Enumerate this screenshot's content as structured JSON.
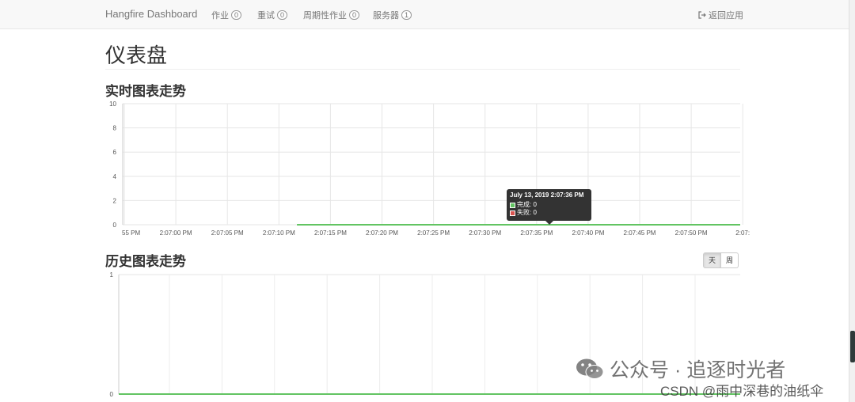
{
  "navbar": {
    "brand": "Hangfire Dashboard",
    "items": [
      {
        "label": "作业",
        "count": "0"
      },
      {
        "label": "重试",
        "count": "0"
      },
      {
        "label": "周期性作业",
        "count": "0"
      },
      {
        "label": "服务器",
        "count": "1"
      }
    ],
    "back_label": "返回应用",
    "back_icon": "sign-out-icon"
  },
  "page": {
    "title": "仪表盘",
    "realtime_title": "实时图表走势",
    "history_title": "历史图表走势",
    "range_toggle": [
      {
        "label": "天",
        "active": true
      },
      {
        "label": "周",
        "active": false
      }
    ]
  },
  "tooltip": {
    "title": "July 13, 2019 2:07:36 PM",
    "rows": [
      {
        "label": "完成: 0",
        "color": "#62c462"
      },
      {
        "label": "失败: 0",
        "color": "#d9534f"
      }
    ]
  },
  "colors": {
    "succeeded": "#62c462",
    "failed": "#d9534f"
  },
  "watermark": {
    "line1": "公众号 · 追逐时光者",
    "line2": "CSDN @雨中深巷的油纸伞",
    "icon": "wechat-icon"
  },
  "chart_data": [
    {
      "type": "line",
      "title": "实时图表走势",
      "x": [
        "55 PM",
        "2:07:00 PM",
        "2:07:05 PM",
        "2:07:10 PM",
        "2:07:15 PM",
        "2:07:20 PM",
        "2:07:25 PM",
        "2:07:30 PM",
        "2:07:35 PM",
        "2:07:40 PM",
        "2:07:45 PM",
        "2:07:50 PM",
        "2:07:"
      ],
      "yticks": [
        0,
        2,
        4,
        6,
        8,
        10
      ],
      "ylim": [
        0,
        10
      ],
      "grid": true,
      "series": [
        {
          "name": "完成",
          "values": [
            0,
            0,
            0,
            0,
            0,
            0,
            0,
            0,
            0,
            0,
            0,
            0,
            0
          ],
          "start_index": 3.35
        }
      ]
    },
    {
      "type": "line",
      "title": "历史图表走势",
      "yticks": [
        0,
        1
      ],
      "ylim": [
        0,
        1
      ],
      "grid": true,
      "series": [
        {
          "name": "完成",
          "values": [
            0,
            0,
            0,
            0,
            0,
            0,
            0,
            0,
            0,
            0,
            0,
            0
          ]
        }
      ]
    }
  ]
}
